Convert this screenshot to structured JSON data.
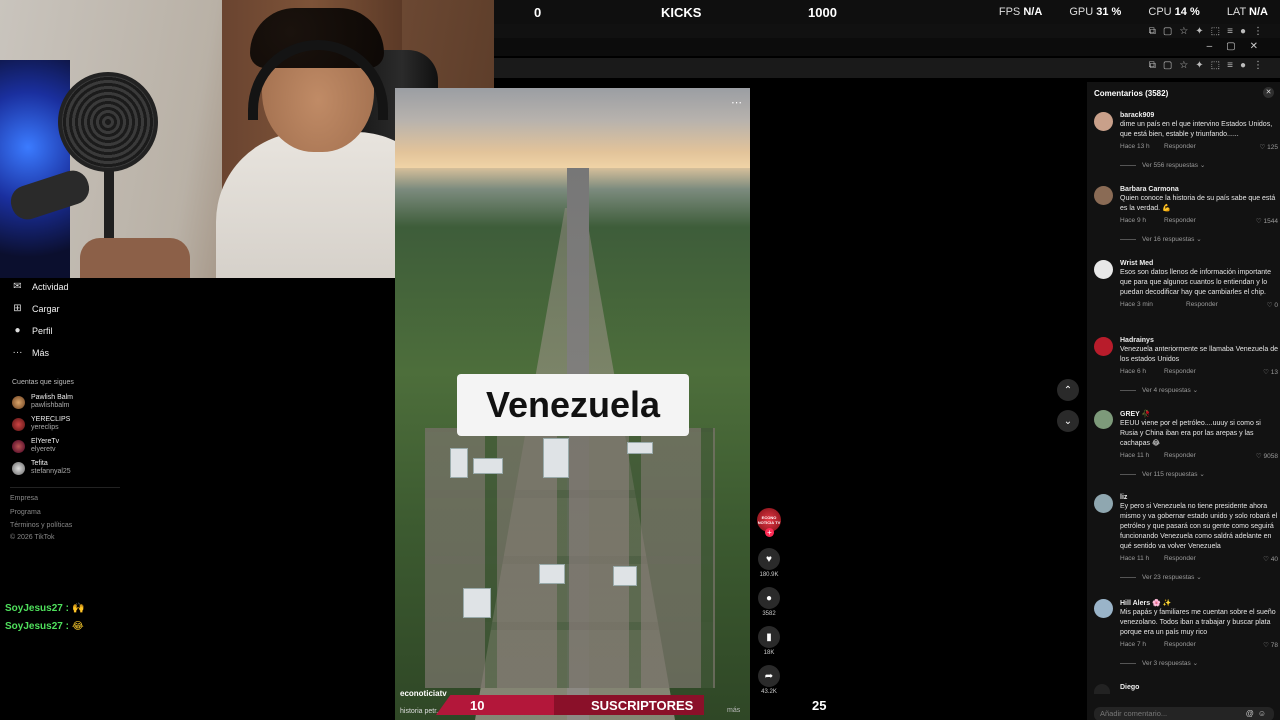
{
  "topbar": {
    "left_value": "0",
    "center_label": "KICKS",
    "right_value": "1000",
    "fps_label": "FPS",
    "fps_value": "N/A",
    "gpu_label": "GPU",
    "gpu_value": "31 %",
    "cpu_label": "CPU",
    "cpu_value": "14 %",
    "lat_label": "LAT",
    "lat_value": "N/A"
  },
  "sidebar": {
    "items": [
      {
        "label": "Actividad",
        "icon": "activity-icon"
      },
      {
        "label": "Cargar",
        "icon": "upload-icon"
      },
      {
        "label": "Perfil",
        "icon": "profile-icon"
      },
      {
        "label": "Más",
        "icon": "more-icon"
      }
    ],
    "following_title": "Cuentas que sigues",
    "following": [
      {
        "name": "Pawlish Balm",
        "handle": "pawlishbalm"
      },
      {
        "name": "YERECLIPS",
        "handle": "yereclips"
      },
      {
        "name": "ElYereTv",
        "handle": "elyeretv"
      },
      {
        "name": "Tefita",
        "handle": "stefannyal25"
      }
    ],
    "footer": [
      "Empresa",
      "Programa",
      "Términos y políticas",
      "© 2026 TikTok"
    ]
  },
  "chat": [
    {
      "user": "SoyJesus27",
      "sep": ":",
      "emoji": "🙌"
    },
    {
      "user": "SoyJesus27",
      "sep": ":",
      "emoji": "😂"
    }
  ],
  "video": {
    "overlay_text": "Venezuela",
    "author": "econoticiatv",
    "description": "historia petr...",
    "more": "más"
  },
  "actions": {
    "avatar_text": "ECONO NOTICIA TV",
    "likes": "180.9K",
    "comments": "3582",
    "saves": "18K",
    "shares": "43.2K"
  },
  "comments": {
    "header": "Comentarios (3582)",
    "input_placeholder": "Añadir comentario...",
    "items": [
      {
        "user": "barack909",
        "text": "dime un país en el que intervino Estados Unidos, que está bien, estable y triunfando......",
        "time": "Hace 13 h",
        "reply": "Responder",
        "likes": "125",
        "more": "Ver 556 respuestas",
        "color": "#c9a08a"
      },
      {
        "user": "Barbara Carmona",
        "text": "Quien conoce la historia de su país sabe que está es la verdad. 💪",
        "time": "Hace 9 h",
        "reply": "Responder",
        "likes": "1544",
        "more": "Ver 16 respuestas",
        "color": "#8a6b55"
      },
      {
        "user": "Wrist Med",
        "text": "Esos son datos llenos de información importante que para que algunos cuantos lo entiendan y lo puedan decodificar hay que cambiarles el chip.",
        "time": "Hace 3 min",
        "reply": "Responder",
        "likes": "0",
        "more": "",
        "color": "#e8e8e8"
      },
      {
        "user": "Hadrainys",
        "text": "Venezuela anteriormente se llamaba Venezuela de los estados Unidos",
        "time": "Hace 6 h",
        "reply": "Responder",
        "likes": "13",
        "more": "Ver 4 respuestas",
        "color": "#b81c2b"
      },
      {
        "user": "GREY 🥀",
        "text": "EEUU viene por el petróleo....uuuy si como si Rusia y China iban era por las arepas y las cachapas 😂",
        "time": "Hace 11 h",
        "reply": "Responder",
        "likes": "9058",
        "more": "Ver 115 respuestas",
        "color": "#7d9a7a"
      },
      {
        "user": "liz",
        "text": "Ey pero si Venezuela no tiene presidente ahora mismo y va gobernar estado unido y solo robará el petróleo y que pasará con su gente como seguirá funcionando Venezuela como saldrá adelante en qué sentido va volver Venezuela",
        "time": "Hace 11 h",
        "reply": "Responder",
        "likes": "40",
        "more": "Ver 23 respuestas",
        "color": "#8fa7b0"
      },
      {
        "user": "Hill Alers 🌸 ✨",
        "text": "Mis papás y familiares me cuentan sobre el sueño venezolano. Todos iban a trabajar y buscar plata porque era un país muy rico",
        "time": "Hace 7 h",
        "reply": "Responder",
        "likes": "78",
        "more": "Ver 3 respuestas",
        "color": "#9ab4c9"
      },
      {
        "user": "Diego",
        "text": "",
        "time": "",
        "reply": "",
        "likes": "",
        "more": "",
        "color": "#222"
      }
    ]
  },
  "bottom_overlay": {
    "left_value": "10",
    "label": "SUSCRIPTORES",
    "right_value": "25"
  }
}
